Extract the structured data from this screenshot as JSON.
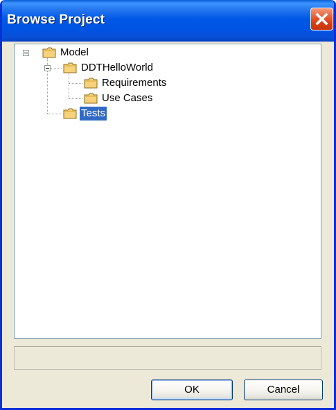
{
  "window": {
    "title": "Browse Project",
    "close_icon": "close-x-icon",
    "accent_color": "#0054e3",
    "close_color": "#e5572e"
  },
  "tree": {
    "selection_color": "#316ac5",
    "folder_icon": "folder-icon",
    "nodes": [
      {
        "label": "Model",
        "expanded": true,
        "selected": false
      },
      {
        "label": "DDTHelloWorld",
        "expanded": true,
        "selected": false
      },
      {
        "label": "Requirements",
        "expanded": false,
        "selected": false
      },
      {
        "label": "Use Cases",
        "expanded": false,
        "selected": false
      },
      {
        "label": "Tests",
        "expanded": false,
        "selected": true
      }
    ]
  },
  "status": {
    "text": ""
  },
  "buttons": {
    "ok_label": "OK",
    "cancel_label": "Cancel"
  }
}
